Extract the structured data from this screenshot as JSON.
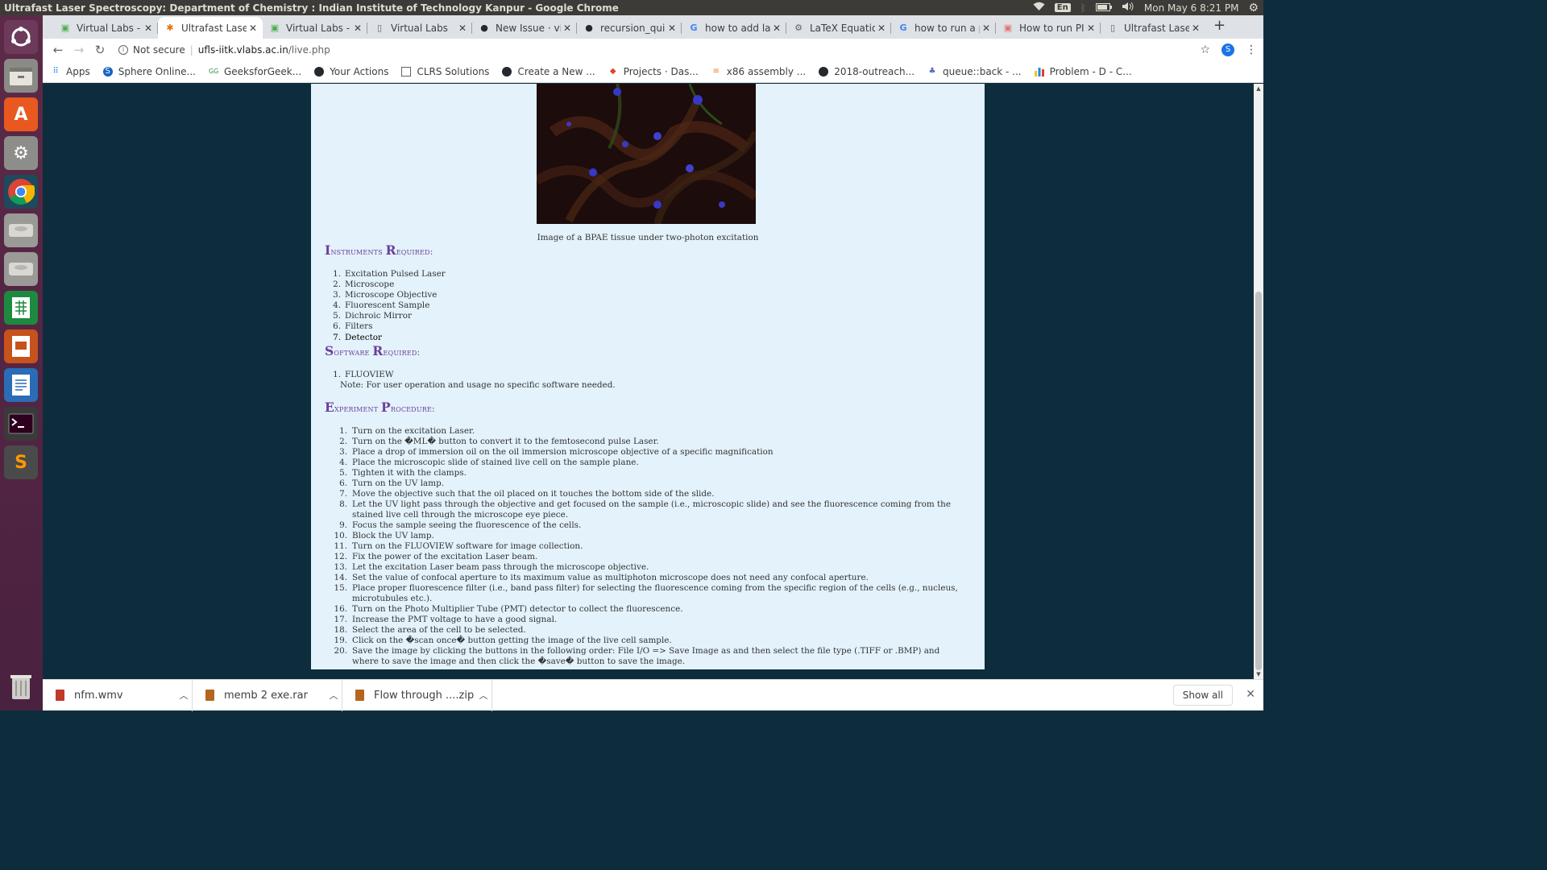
{
  "window": {
    "title": "Ultrafast Laser Spectroscopy: Department of Chemistry : Indian Institute of Technology Kanpur - Google Chrome",
    "lang": "En",
    "clock": "Mon May 6  8:21 PM"
  },
  "tabs": [
    {
      "label": "Virtual Labs - ",
      "icon": "virtual-labs-favicon"
    },
    {
      "label": "Ultrafast Laser",
      "icon": "ultrafast-favicon"
    },
    {
      "label": "Virtual Labs - ",
      "icon": "virtual-labs-favicon"
    },
    {
      "label": "Virtual Labs",
      "icon": "page-favicon"
    },
    {
      "label": "New Issue · vir",
      "icon": "github-favicon"
    },
    {
      "label": "recursion_qui",
      "icon": "github-favicon"
    },
    {
      "label": "how to add la",
      "icon": "google-favicon"
    },
    {
      "label": "LaTeX Equatio",
      "icon": "gear-favicon"
    },
    {
      "label": "how to run a p",
      "icon": "google-favicon"
    },
    {
      "label": "How to run PI",
      "icon": "page-favicon"
    },
    {
      "label": "Ultrafast Laser",
      "icon": "page-favicon"
    }
  ],
  "address": {
    "security": "Not secure",
    "host": "ufls-iitk.vlabs.ac.in",
    "path": "/live.php"
  },
  "avatar_letter": "S",
  "bookmarks": [
    {
      "label": "Apps",
      "icon": "apps-icon"
    },
    {
      "label": "Sphere Online...",
      "icon": "sphere-icon"
    },
    {
      "label": "GeeksforGeek...",
      "icon": "gfg-icon"
    },
    {
      "label": "Your Actions",
      "icon": "github-icon"
    },
    {
      "label": "CLRS Solutions",
      "icon": "page-icon"
    },
    {
      "label": "Create a New ...",
      "icon": "github-icon"
    },
    {
      "label": "Projects · Das...",
      "icon": "gitlab-icon"
    },
    {
      "label": "x86 assembly ...",
      "icon": "stackoverflow-icon"
    },
    {
      "label": "2018-outreach...",
      "icon": "github-icon"
    },
    {
      "label": "queue::back - ...",
      "icon": "cpp-icon"
    },
    {
      "label": "Problem - D - C...",
      "icon": "codeforces-icon"
    }
  ],
  "page": {
    "figure_caption": "Image of a BPAE tissue under two-photon excitation",
    "instruments_heading": {
      "cap1": "I",
      "rest1": "nstruments ",
      "cap2": "R",
      "rest2": "equired:"
    },
    "instruments": [
      {
        "n": "1.",
        "t": "Excitation Pulsed Laser"
      },
      {
        "n": "2.",
        "t": "Microscope"
      },
      {
        "n": "3.",
        "t": "Microscope Objective"
      },
      {
        "n": "4.",
        "t": "Fluorescent Sample"
      },
      {
        "n": "5.",
        "t": "Dichroic Mirror"
      },
      {
        "n": "6.",
        "t": "Filters"
      },
      {
        "n": "7.",
        "t": "Detector"
      }
    ],
    "software_heading": {
      "cap1": "S",
      "rest1": "oftware ",
      "cap2": "R",
      "rest2": "equired:"
    },
    "software": [
      {
        "n": "1.",
        "t": "FLUOVIEW"
      }
    ],
    "software_note": "Note: For user operation and usage no specific software needed.",
    "procedure_heading": {
      "cap1": "E",
      "rest1": "xperiment ",
      "cap2": "P",
      "rest2": "rocedure:"
    },
    "procedure": [
      {
        "n": "1.",
        "t": "Turn on the excitation Laser."
      },
      {
        "n": "2.",
        "t": "Turn on the �ML� button to convert it to the femtosecond pulse Laser."
      },
      {
        "n": "3.",
        "t": "Place a drop of immersion oil on the oil immersion microscope objective of a specific magnification"
      },
      {
        "n": "4.",
        "t": "Place the microscopic slide of stained live cell on the sample plane."
      },
      {
        "n": "5.",
        "t": "Tighten it with the clamps."
      },
      {
        "n": "6.",
        "t": "Turn on the UV lamp."
      },
      {
        "n": "7.",
        "t": "Move the objective such that the oil placed on it touches the bottom side of the slide."
      },
      {
        "n": "8.",
        "t": "Let the UV light pass through the objective and get focused on the sample (i.e., microscopic slide) and see the fluorescence coming from the stained live cell through the microscope eye piece."
      },
      {
        "n": "9.",
        "t": "Focus the sample seeing the fluorescence of the cells."
      },
      {
        "n": "10.",
        "t": "Block the UV lamp."
      },
      {
        "n": "11.",
        "t": "Turn on the FLUOVIEW software for image collection."
      },
      {
        "n": "12.",
        "t": "Fix the power of the excitation Laser beam."
      },
      {
        "n": "13.",
        "t": "Let the excitation Laser beam pass through the microscope objective."
      },
      {
        "n": "14.",
        "t": "Set the value of confocal aperture to its maximum value as multiphoton microscope does not need any confocal aperture."
      },
      {
        "n": "15.",
        "t": "Place proper fluorescence filter (i.e., band pass filter) for selecting the fluorescence coming from the specific region of the cells (e.g., nucleus, microtubules etc.)."
      },
      {
        "n": "16.",
        "t": "Turn on the Photo Multiplier Tube (PMT) detector to collect the fluorescence."
      },
      {
        "n": "17.",
        "t": "Increase the PMT voltage to have a good signal."
      },
      {
        "n": "18.",
        "t": "Select the area of the cell to be selected."
      },
      {
        "n": "19.",
        "t": "Click on the �scan once� button getting the image of the live cell sample."
      },
      {
        "n": "20.",
        "t": "Save the image by clicking the buttons in the following order: File I/O => Save Image as and then select the file type (.TIFF or .BMP) and where to save the image and then click the �save� button to save the image."
      }
    ]
  },
  "downloads": [
    {
      "name": "nfm.wmv",
      "color": "#c0392b"
    },
    {
      "name": "memb 2 exe.rar",
      "color": "#b5651d"
    },
    {
      "name": "Flow through ....zip",
      "color": "#b5651d"
    }
  ],
  "show_all_label": "Show all"
}
